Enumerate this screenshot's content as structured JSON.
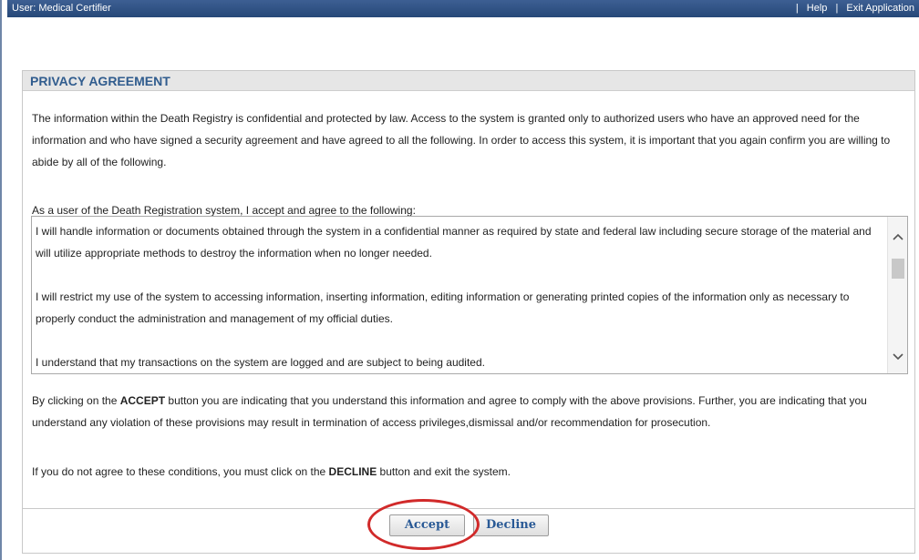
{
  "header": {
    "user_label": "User: Medical Certifier",
    "separator": "|",
    "help_label": "Help",
    "exit_label": "Exit Application"
  },
  "panel": {
    "title": "PRIVACY AGREEMENT",
    "paragraph1": "The information within the Death Registry is confidential and protected by law. Access to the system is granted only to authorized users who have an approved need for the information and who have signed a security agreement and have agreed to all the following. In order to access this system, it is important that you again confirm you are willing to abide by all of the following.",
    "terms_intro": "As a user of the Death Registration system, I accept and agree to the following:",
    "terms": [
      "I will handle information or documents obtained through the system in a confidential manner as required by state and federal law including secure storage of the material and will utilize appropriate methods to destroy the information when no longer needed.",
      "I will restrict my use of the system to accessing information, inserting information, editing information or generating printed copies of the information only as necessary to properly conduct the administration and management of my official duties.",
      "I understand that my transactions on the system are logged and are subject to being audited."
    ],
    "accept_para": {
      "pre": "By clicking on the ",
      "bold": "ACCEPT",
      "post": " button you are indicating that you understand this information and agree to comply with the above provisions. Further, you are indicating that you understand any violation of these provisions may result in termination of access privileges,dismissal and/or recommendation for prosecution."
    },
    "decline_para": {
      "pre": "If you do not agree to these conditions, you must click on the ",
      "bold": "DECLINE",
      "post": " button and exit the system."
    }
  },
  "buttons": {
    "accept_label": "Accept",
    "decline_label": "Decline"
  },
  "icons": {
    "scroll_up": "chevron-up-icon",
    "scroll_down": "chevron-down-icon"
  },
  "colors": {
    "header_bar": "#2f5286",
    "title_text": "#305c8e",
    "highlight_ring": "#d12a2a"
  }
}
